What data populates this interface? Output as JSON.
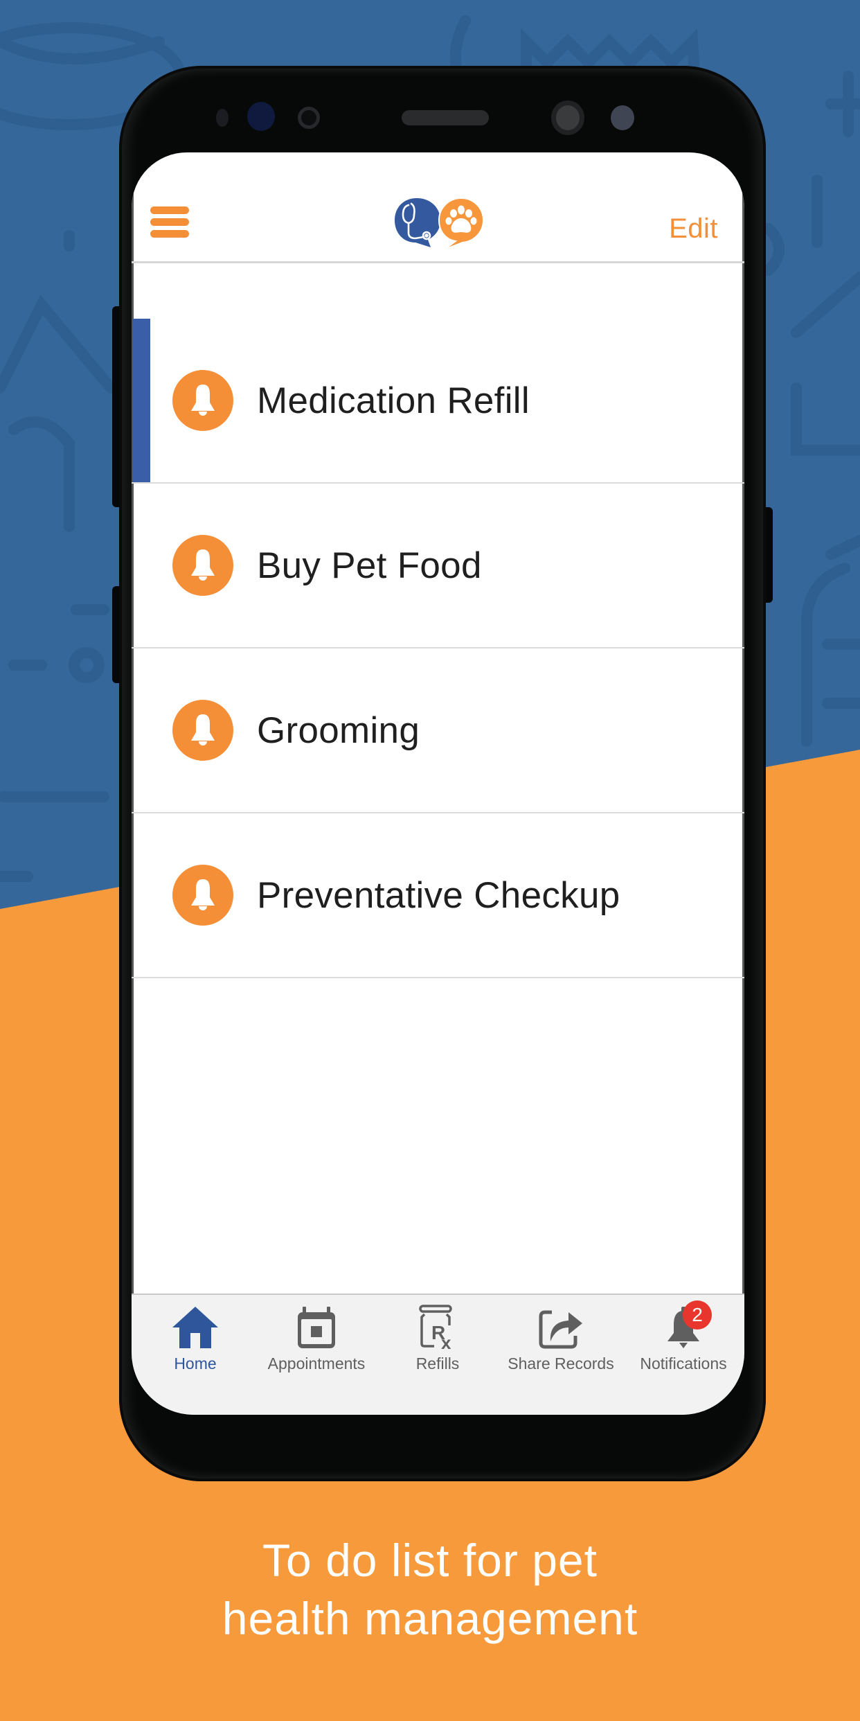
{
  "colors": {
    "background_top": "#35679a",
    "background_bottom": "#f79a3b",
    "accent_orange": "#f48f37",
    "brand_blue": "#3a5ea8",
    "tab_active": "#2f569a",
    "tab_inactive": "#5f5f5f",
    "badge_red": "#e8362f"
  },
  "header": {
    "menu_icon": "hamburger-icon",
    "logo": "stethoscope-and-paw-speech-bubbles-logo",
    "edit_label": "Edit"
  },
  "todo_list": {
    "items": [
      {
        "label": "Medication Refill",
        "icon": "bell-icon",
        "selected": true
      },
      {
        "label": "Buy Pet Food",
        "icon": "bell-icon",
        "selected": false
      },
      {
        "label": "Grooming",
        "icon": "bell-icon",
        "selected": false
      },
      {
        "label": "Preventative Checkup",
        "icon": "bell-icon",
        "selected": false
      }
    ]
  },
  "tab_bar": {
    "tabs": [
      {
        "label": "Home",
        "icon": "home-icon",
        "active": true
      },
      {
        "label": "Appointments",
        "icon": "calendar-icon",
        "active": false
      },
      {
        "label": "Refills",
        "icon": "prescription-icon",
        "active": false
      },
      {
        "label": "Share Records",
        "icon": "share-icon",
        "active": false
      },
      {
        "label": "Notifications",
        "icon": "bell-icon",
        "active": false,
        "badge": "2"
      }
    ]
  },
  "caption": {
    "line1": "To do list for pet",
    "line2": "health management"
  }
}
